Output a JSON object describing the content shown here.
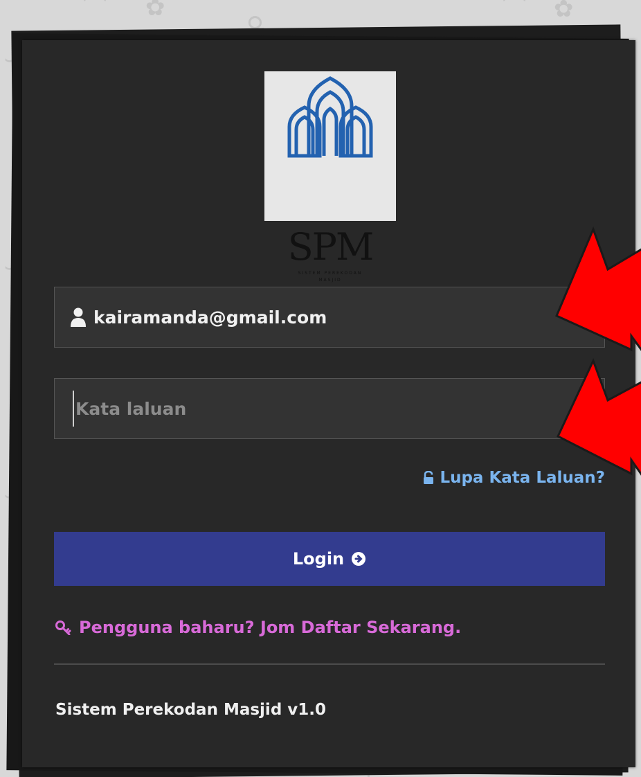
{
  "logo": {
    "main_text": "SPM",
    "sub_line1": "SISTEM PEREKODAN",
    "sub_line2": "MASJID"
  },
  "login_form": {
    "email_value": "kairamanda@gmail.com",
    "password_placeholder": "Kata laluan",
    "forgot_password_label": "Lupa Kata Laluan?",
    "login_button_label": "Login",
    "register_link_label": "Pengguna baharu? Jom Daftar Sekarang."
  },
  "footer": {
    "app_version_text": "Sistem Perekodan Masjid v1.0"
  },
  "icons": {
    "email_field": "user-icon",
    "forgot_password": "unlock-icon",
    "login_button": "arrow-circle-right-icon",
    "register_link": "key-icon"
  },
  "colors": {
    "page_background": "#d8d8d8",
    "card_background": "#282828",
    "input_background": "#333333",
    "login_button": "#333c8f",
    "forgot_link": "#7ab4ee",
    "register_link": "#d86ad8",
    "annotation_arrows": "#ff0000"
  }
}
